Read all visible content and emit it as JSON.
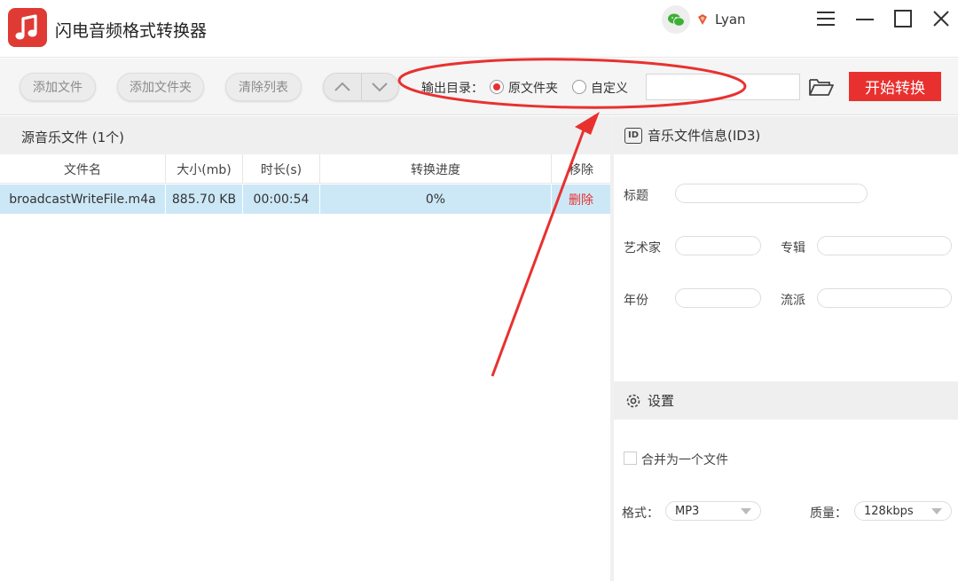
{
  "app": {
    "title": "闪电音频格式转换器",
    "user_name": "Lyan"
  },
  "toolbar": {
    "add_file": "添加文件",
    "add_folder": "添加文件夹",
    "clear_list": "清除列表",
    "output_label": "输出目录：",
    "option_original": "原文件夹",
    "option_custom": "自定义",
    "path_value": "",
    "start_label": "开始转换"
  },
  "file_list": {
    "title": "源音乐文件 (1个)",
    "columns": [
      "文件名",
      "大小(mb)",
      "时长(s)",
      "转换进度",
      "移除"
    ],
    "rows": [
      {
        "name": "broadcastWriteFile.m4a",
        "size": "885.70 KB",
        "duration": "00:00:54",
        "progress": "0%",
        "remove": "删除"
      }
    ]
  },
  "id3": {
    "title": "音乐文件信息(ID3)",
    "icon_text": "ID",
    "title_label": "标题",
    "artist_label": "艺术家",
    "album_label": "专辑",
    "year_label": "年份",
    "genre_label": "流派"
  },
  "settings": {
    "title": "设置",
    "merge_label": "合并为一个文件",
    "format_label": "格式：",
    "format_value": "MP3",
    "quality_label": "质量：",
    "quality_value": "128kbps"
  },
  "colors": {
    "accent": "#e8312f",
    "row_selected": "#cce8f7"
  }
}
